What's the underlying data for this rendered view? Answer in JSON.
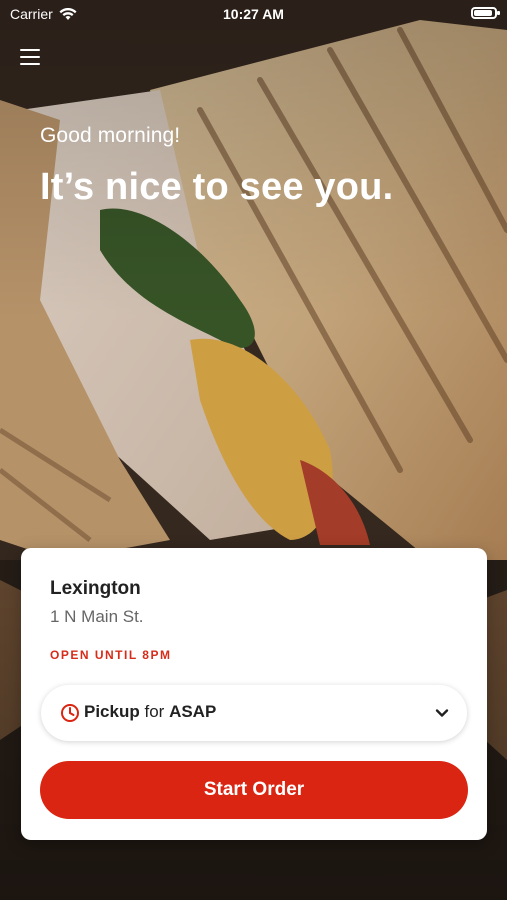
{
  "status_bar": {
    "carrier": "Carrier",
    "time": "10:27 AM"
  },
  "header": {
    "greeting": "Good morning!",
    "headline": "It’s nice to see you."
  },
  "store_card": {
    "name": "Lexington",
    "address": "1 N Main St.",
    "hours": "OPEN UNTIL 8PM",
    "mode": "Pickup",
    "for_word": "for",
    "when": "ASAP",
    "start_button": "Start Order"
  },
  "colors": {
    "accent": "#d92511",
    "hours_text": "#d62c1a"
  },
  "icons": [
    "wifi-icon",
    "battery-icon",
    "menu-icon",
    "clock-icon",
    "chevron-down-icon"
  ]
}
